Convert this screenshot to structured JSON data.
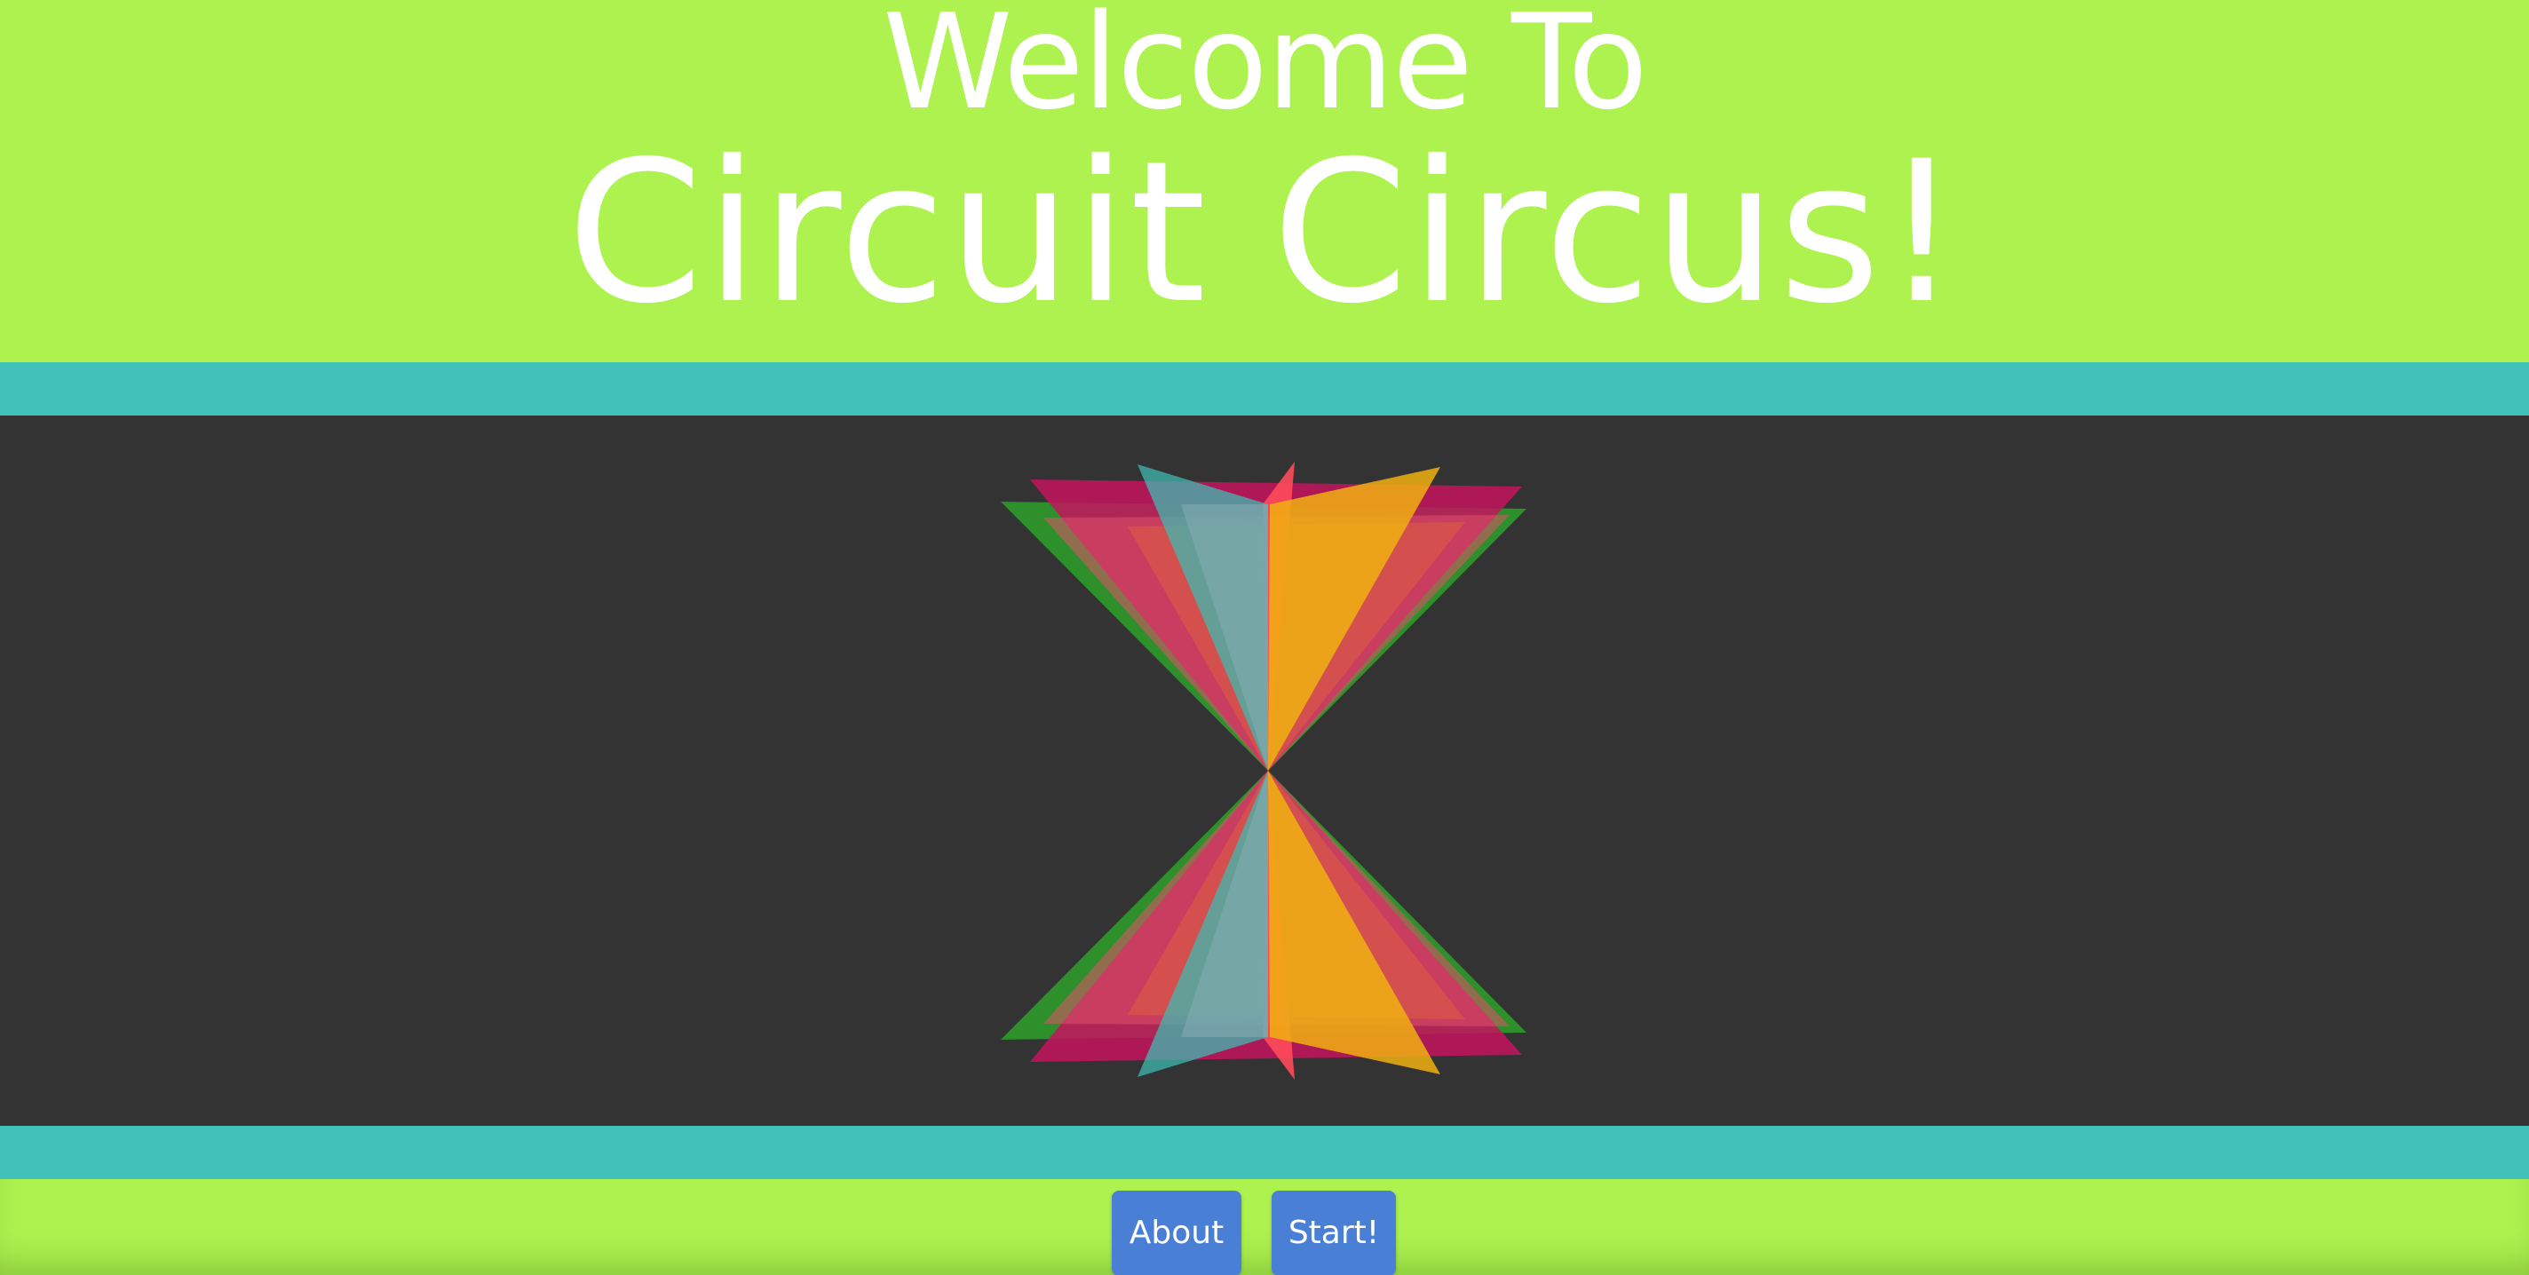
{
  "header": {
    "welcome": "Welcome To",
    "title": "Circuit Circus!"
  },
  "footer": {
    "about_label": "About",
    "start_label": "Start!"
  },
  "colors": {
    "background": "#adf24f",
    "stripe": "#40c0b8",
    "stage": "#333333",
    "button": "#4a7fd6",
    "text": "#ffffff"
  }
}
